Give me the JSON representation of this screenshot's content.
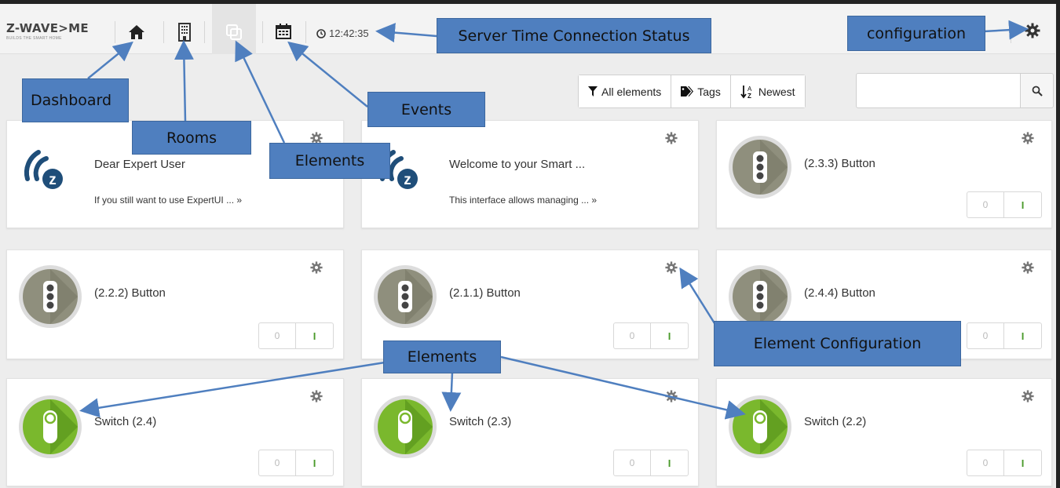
{
  "navbar": {
    "logo": "Z-WAVE>ME",
    "logo_tagline": "BUILDS THE SMART HOME",
    "server_time": "12:42:35",
    "icons": [
      "home-icon",
      "rooms-icon",
      "elements-icon",
      "calendar-icon",
      "clock-icon",
      "gear-icon"
    ]
  },
  "annotations": {
    "server_time": "Server Time Connection Status",
    "configuration": "configuration",
    "dashboard": "Dashboard",
    "rooms": "Rooms",
    "elements_top": "Elements",
    "events": "Events",
    "element_configuration": "Element Configuration",
    "elements_bottom": "Elements"
  },
  "filters": {
    "all_elements": "All elements",
    "tags": "Tags",
    "newest": "Newest",
    "search_placeholder": ""
  },
  "cards": [
    {
      "title": "Dear Expert User",
      "desc": "If you still want to use ExpertUI ... »",
      "icon": "zwave-logo"
    },
    {
      "title": "Welcome to your Smart ...",
      "desc": "This interface allows managing ... »",
      "icon": "zwave-logo"
    },
    {
      "title": "(2.3.3) Button",
      "toggle_off": "0",
      "toggle_on": "I",
      "icon": "button-icon"
    },
    {
      "title": "(2.2.2) Button",
      "toggle_off": "0",
      "toggle_on": "I",
      "icon": "button-icon"
    },
    {
      "title": "(2.1.1) Button",
      "toggle_off": "0",
      "toggle_on": "I",
      "icon": "button-icon"
    },
    {
      "title": "(2.4.4) Button",
      "toggle_off": "0",
      "toggle_on": "I",
      "icon": "button-icon"
    },
    {
      "title": "Switch (2.4)",
      "toggle_off": "0",
      "toggle_on": "I",
      "icon": "switch-icon"
    },
    {
      "title": "Switch (2.3)",
      "toggle_off": "0",
      "toggle_on": "I",
      "icon": "switch-icon"
    },
    {
      "title": "Switch (2.2)",
      "toggle_off": "0",
      "toggle_on": "I",
      "icon": "switch-icon"
    }
  ],
  "colors": {
    "callout": "#4f7fbf",
    "arrow": "#4f7fbf",
    "switch_green": "#7ab82d",
    "button_gray": "#8f8f7d",
    "zwave_blue": "#1f4e79"
  }
}
